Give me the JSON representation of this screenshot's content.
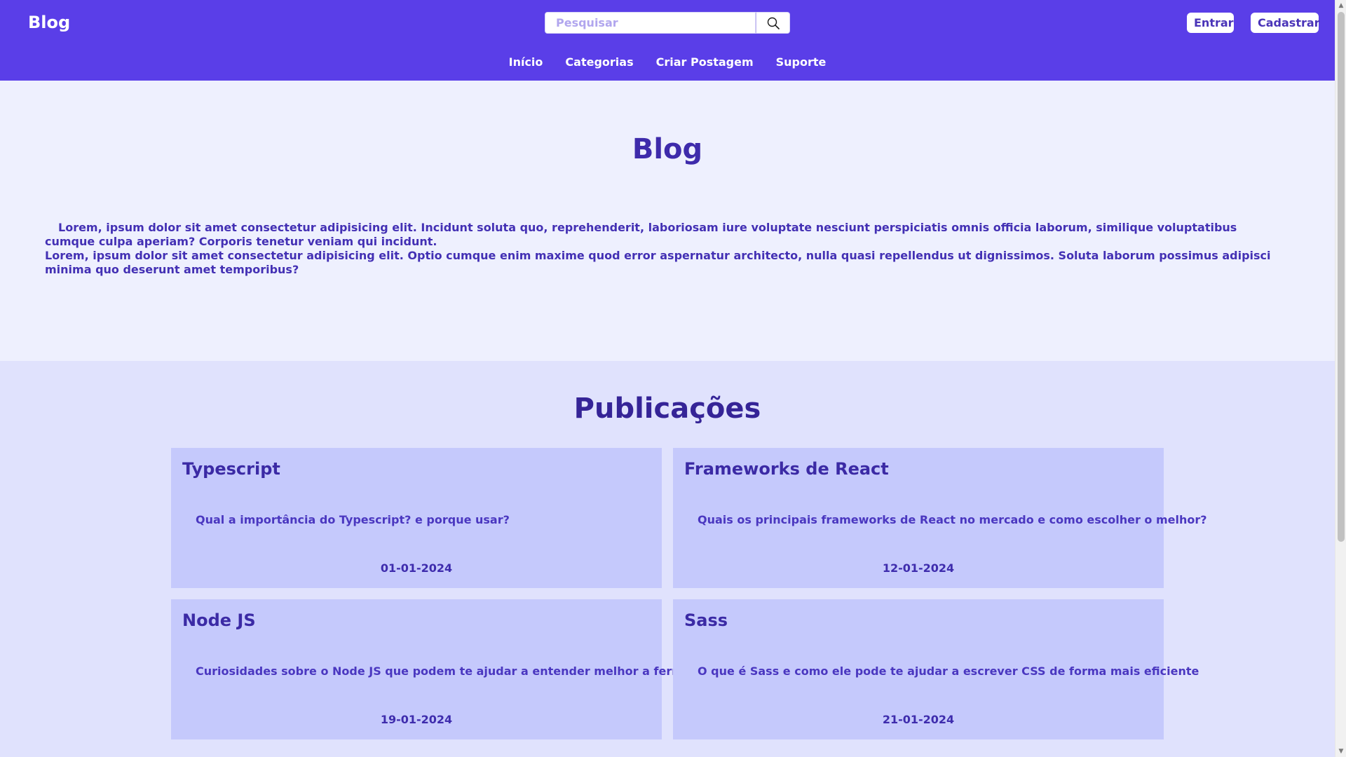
{
  "header": {
    "brand": "Blog",
    "search": {
      "placeholder": "Pesquisar",
      "value": ""
    },
    "login_label": "Entrar",
    "signup_label": "Cadastrar",
    "nav": [
      {
        "label": "Início"
      },
      {
        "label": "Categorias"
      },
      {
        "label": "Criar Postagem"
      },
      {
        "label": "Suporte"
      }
    ]
  },
  "hero": {
    "title": "Blog",
    "paragraph_1": "Lorem, ipsum dolor sit amet consectetur adipisicing elit. Incidunt soluta quo, reprehenderit, laboriosam iure voluptate nesciunt perspiciatis omnis officia laborum, similique voluptatibus cumque culpa aperiam? Corporis tenetur veniam qui incidunt.",
    "paragraph_2": "Lorem, ipsum dolor sit amet consectetur adipisicing elit. Optio cumque enim maxime quod error aspernatur architecto, nulla quasi repellendus ut dignissimos. Soluta laborum possimus adipisci minima quo deserunt amet temporibus?"
  },
  "posts": {
    "title": "Publicações",
    "items": [
      {
        "title": "Typescript",
        "description": "Qual a importância do Typescript? e porque usar?",
        "date": "01-01-2024"
      },
      {
        "title": "Frameworks de React",
        "description": "Quais os principais frameworks de React no mercado e como escolher o melhor?",
        "date": "12-01-2024"
      },
      {
        "title": "Node JS",
        "description": "Curiosidades sobre o Node JS que podem te ajudar a entender melhor a ferramenta.",
        "date": "19-01-2024"
      },
      {
        "title": "Sass",
        "description": "O que é Sass e como ele pode te ajudar a escrever CSS de forma mais eficiente",
        "date": "21-01-2024"
      }
    ]
  },
  "icons": {
    "search": "search-icon",
    "scroll_up": "scroll-up-arrow-icon",
    "scroll_down": "scroll-down-arrow-icon"
  },
  "colors": {
    "header_bg": "#5a3ee8",
    "hero_bg": "#eef0fe",
    "posts_bg": "#e0e2fd",
    "card_bg": "#c5c9fc",
    "text_primary": "#3e2bab"
  }
}
